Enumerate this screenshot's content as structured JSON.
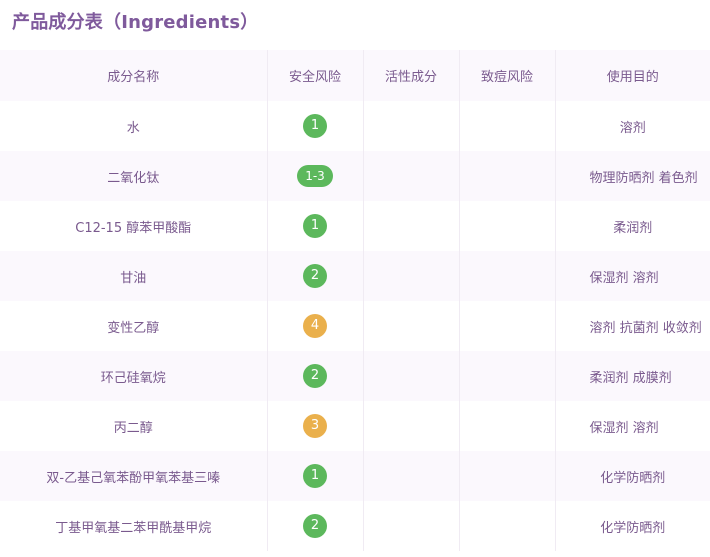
{
  "title": "产品成分表（Ingredients）",
  "columns": {
    "name": "成分名称",
    "safety": "安全风险",
    "active": "活性成分",
    "cancer": "致痘风险",
    "purpose": "使用目的"
  },
  "colors": {
    "risk_low": "#5cb85c",
    "risk_mid": "#eab04c",
    "title": "#7f5a9c",
    "text": "#7a5a8e",
    "row_alt": "#fbf8fd"
  },
  "rows": [
    {
      "name": "水",
      "risk": "1",
      "level": "low",
      "active": "",
      "acne": "",
      "purpose": "溶剂"
    },
    {
      "name": "二氧化钛",
      "risk": "1-3",
      "level": "low",
      "active": "",
      "acne": "",
      "purpose": "物理防晒剂 着色剂"
    },
    {
      "name": "C12-15 醇苯甲酸酯",
      "risk": "1",
      "level": "low",
      "active": "",
      "acne": "",
      "purpose": "柔润剂"
    },
    {
      "name": "甘油",
      "risk": "2",
      "level": "low",
      "active": "",
      "acne": "",
      "purpose": "保湿剂 溶剂"
    },
    {
      "name": "变性乙醇",
      "risk": "4",
      "level": "mid",
      "active": "",
      "acne": "",
      "purpose": "溶剂 抗菌剂 收敛剂"
    },
    {
      "name": "环己硅氧烷",
      "risk": "2",
      "level": "low",
      "active": "",
      "acne": "",
      "purpose": "柔润剂 成膜剂"
    },
    {
      "name": "丙二醇",
      "risk": "3",
      "level": "mid",
      "active": "",
      "acne": "",
      "purpose": "保湿剂 溶剂"
    },
    {
      "name": "双-乙基己氧苯酚甲氧苯基三嗪",
      "risk": "1",
      "level": "low",
      "active": "",
      "acne": "",
      "purpose": "化学防晒剂"
    },
    {
      "name": "丁基甲氧基二苯甲酰基甲烷",
      "risk": "2",
      "level": "low",
      "active": "",
      "acne": "",
      "purpose": "化学防晒剂"
    }
  ]
}
